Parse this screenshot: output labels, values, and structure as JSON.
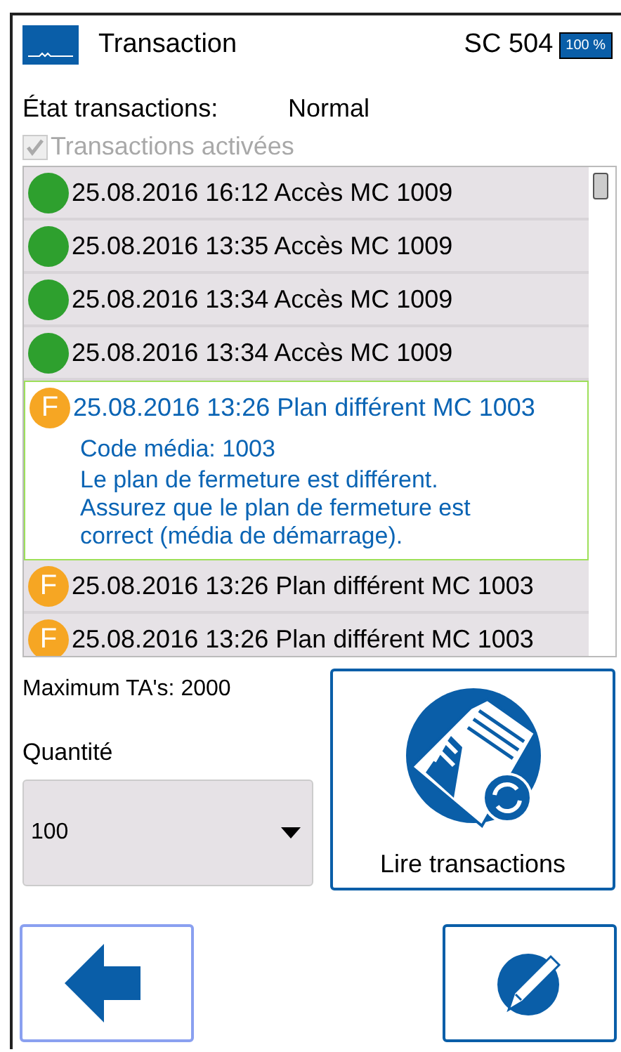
{
  "header": {
    "title": "Transaction",
    "device": "SC 504",
    "battery": "100 %"
  },
  "status": {
    "label": "État transactions:",
    "value": "Normal"
  },
  "enable_checkbox": {
    "label": "Transactions activées",
    "checked": true,
    "disabled": true
  },
  "transactions": [
    {
      "kind": "access",
      "text": "25.08.2016 16:12 Accès MC 1009",
      "selected": false
    },
    {
      "kind": "access",
      "text": "25.08.2016 13:35 Accès MC 1009",
      "selected": false
    },
    {
      "kind": "access",
      "text": "25.08.2016 13:34 Accès MC 1009",
      "selected": false
    },
    {
      "kind": "access",
      "text": "25.08.2016 13:34 Accès MC 1009",
      "selected": false
    },
    {
      "kind": "fault",
      "badge": "F",
      "text": "25.08.2016 13:26 Plan différent MC 1003",
      "selected": true,
      "details": [
        "Code média: 1003",
        "Le plan de fermeture est différent. Assurez que le plan de fermeture est correct (média de démarrage)."
      ]
    },
    {
      "kind": "fault",
      "badge": "F",
      "text": "25.08.2016 13:26 Plan différent MC 1003",
      "selected": false
    },
    {
      "kind": "fault",
      "badge": "F",
      "text": "25.08.2016 13:26 Plan différent MC 1003",
      "selected": false
    }
  ],
  "max_label": "Maximum TA's: 2000",
  "quantity": {
    "label": "Quantité",
    "value": "100"
  },
  "read_button": "Lire transactions"
}
